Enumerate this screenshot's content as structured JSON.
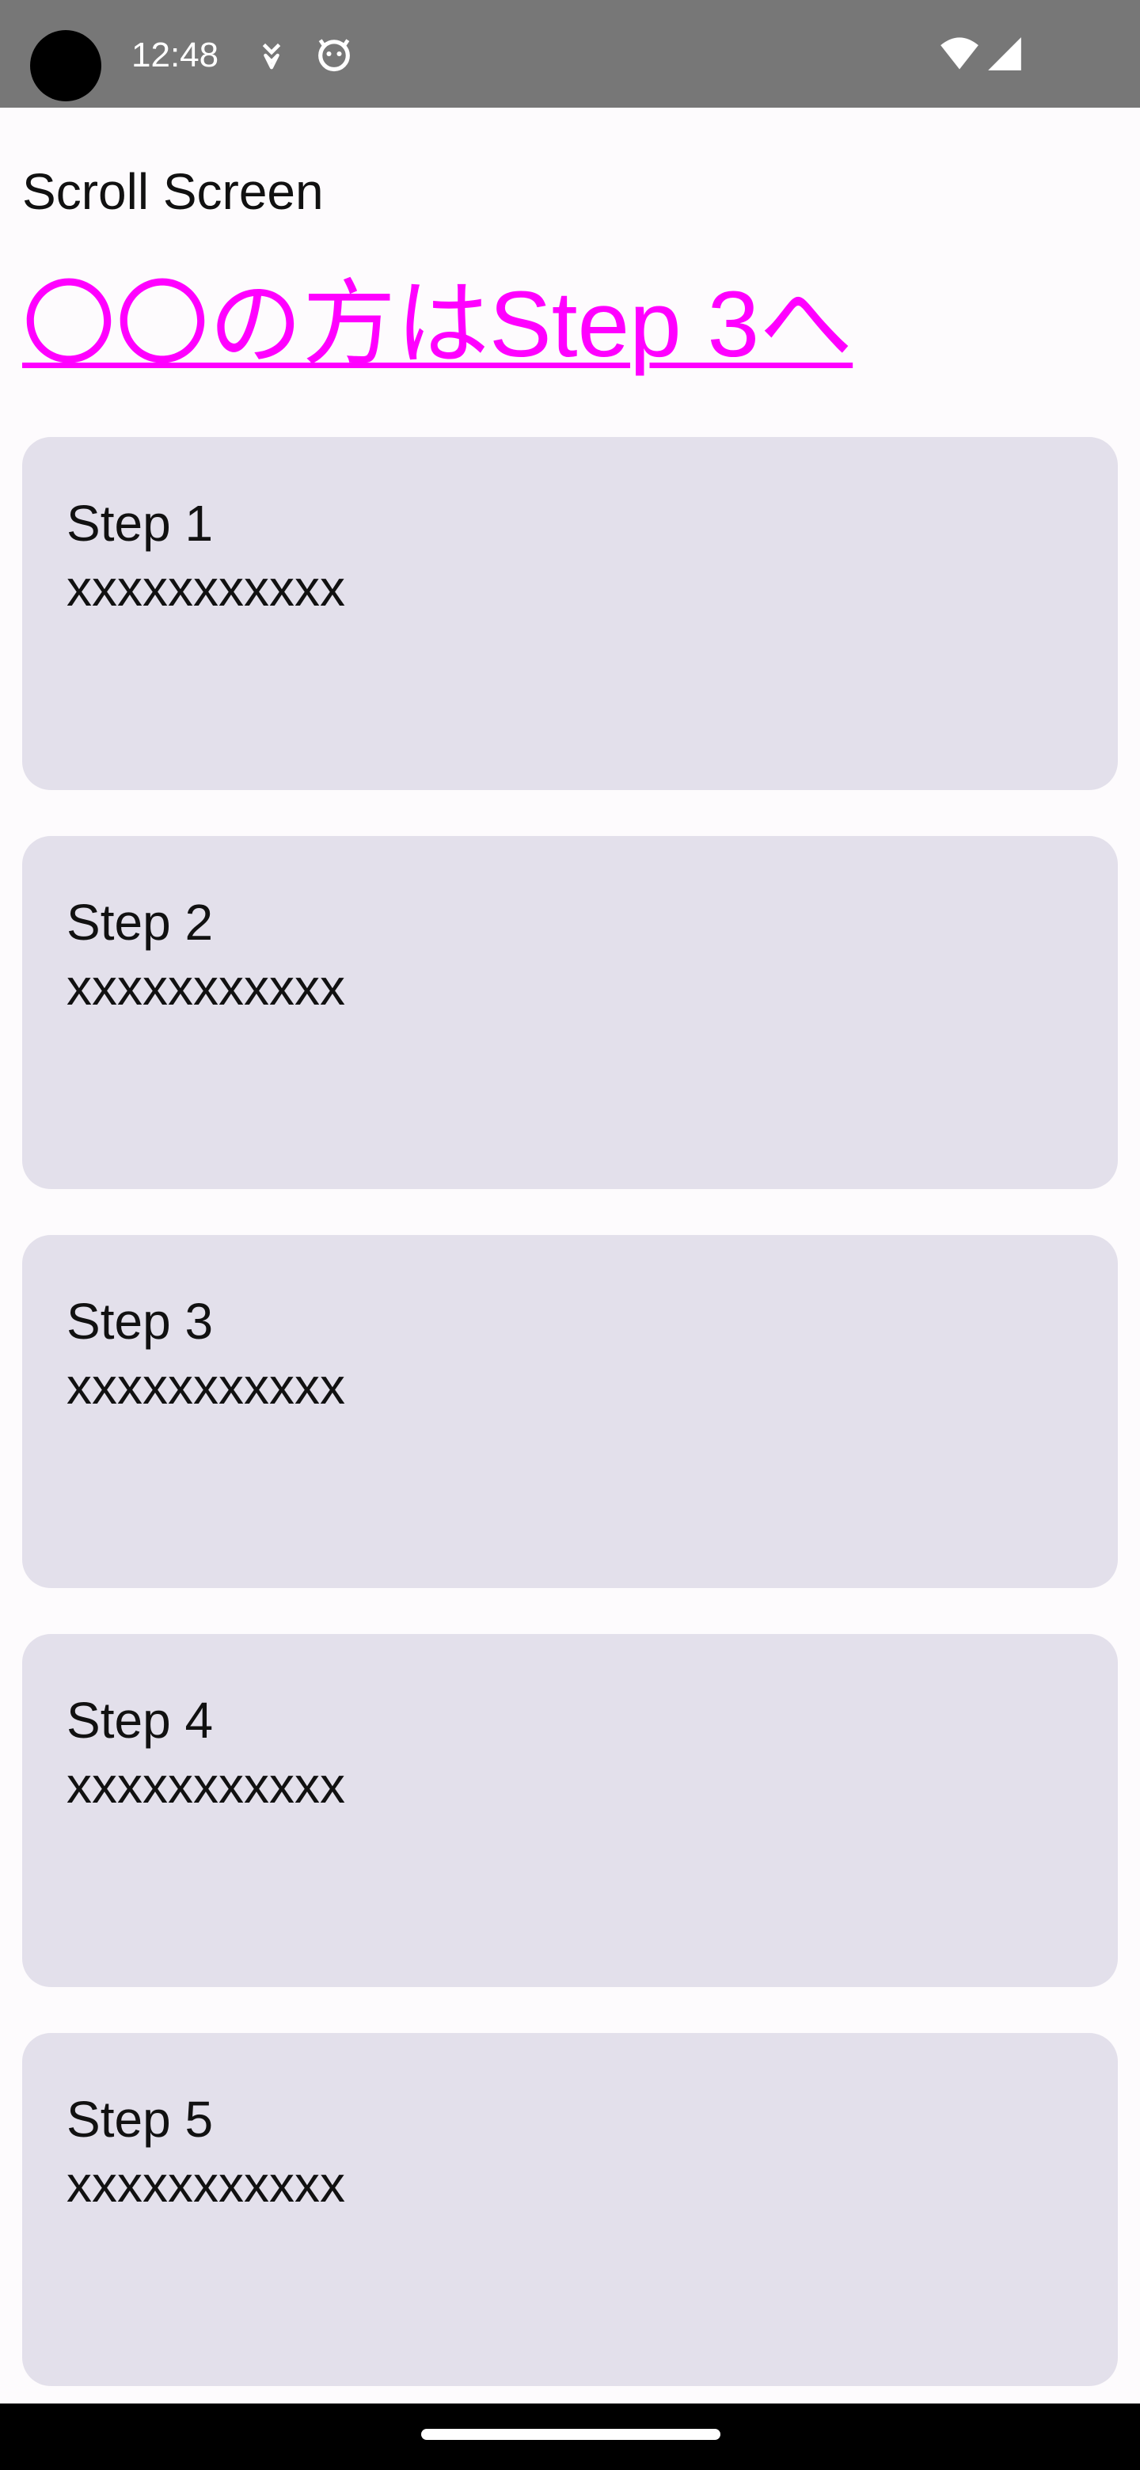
{
  "status_bar": {
    "time": "12:48",
    "icons": [
      "notification-icon",
      "android-icon",
      "wifi-icon",
      "cellular-signal-icon"
    ]
  },
  "app": {
    "title": "Scroll Screen",
    "link_text": "〇〇の方はStep 3へ",
    "link_color": "#ff00ff"
  },
  "steps": [
    {
      "title": "Step 1",
      "body": "xxxxxxxxxxx"
    },
    {
      "title": "Step 2",
      "body": "xxxxxxxxxxx"
    },
    {
      "title": "Step 3",
      "body": "xxxxxxxxxxx"
    },
    {
      "title": "Step 4",
      "body": "xxxxxxxxxxx"
    },
    {
      "title": "Step 5",
      "body": "xxxxxxxxxxx"
    }
  ],
  "colors": {
    "card_background": "#e3e0eb",
    "status_bar_background": "#777777",
    "page_background": "#fdfbfd"
  }
}
